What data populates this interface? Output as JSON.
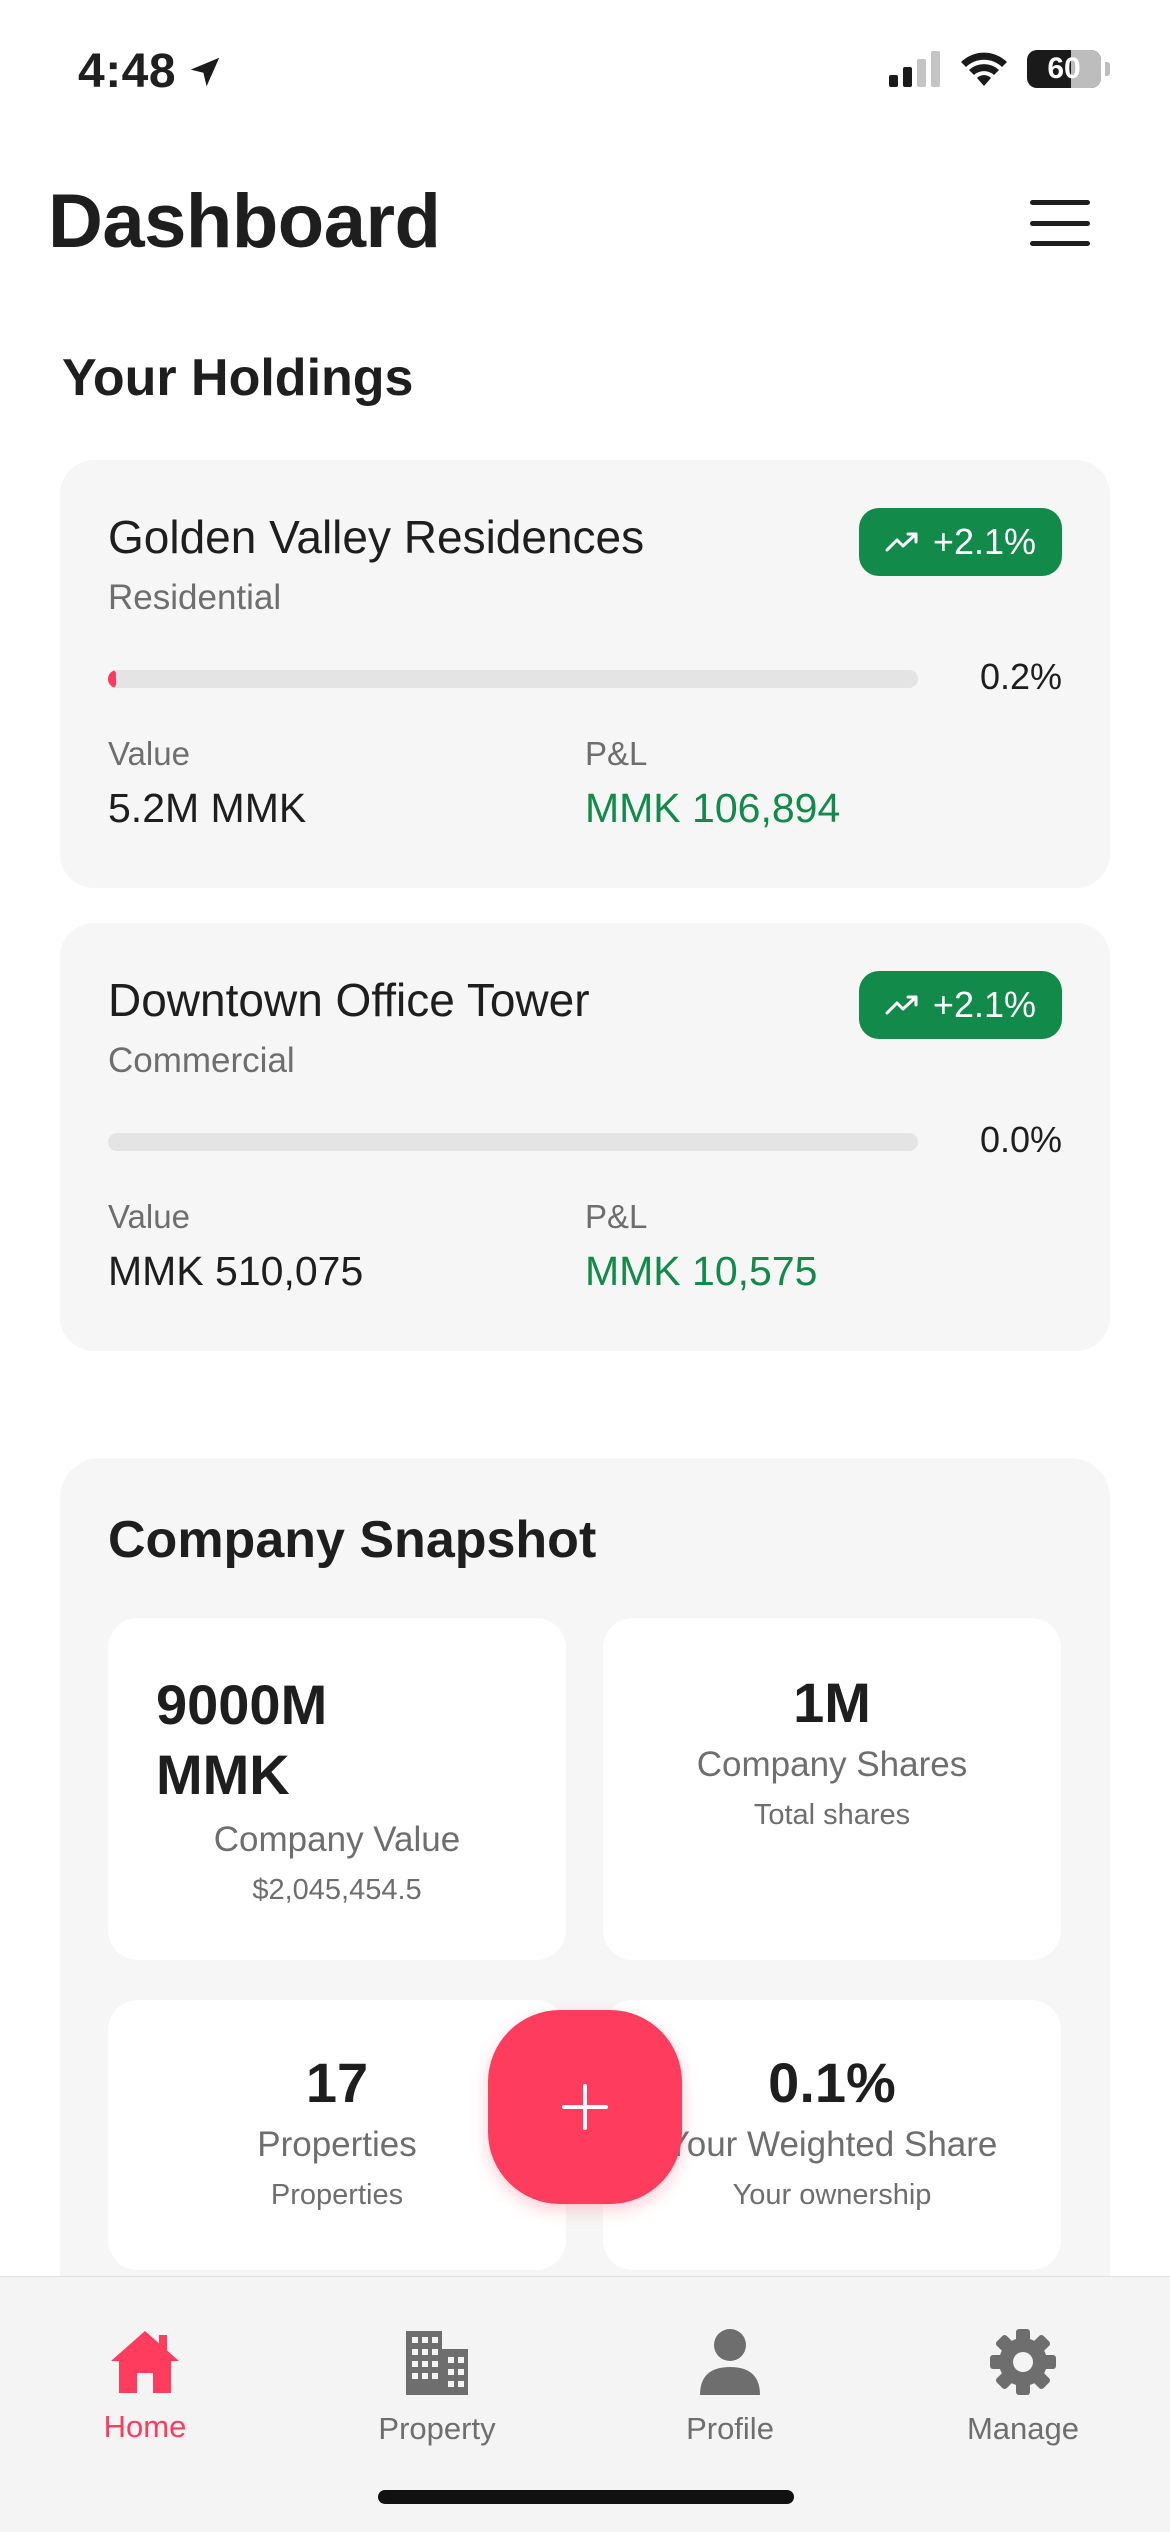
{
  "status_bar": {
    "time": "4:48",
    "battery": "60",
    "icons": [
      "location-arrow-icon",
      "cellular-signal-icon",
      "wifi-icon",
      "battery-icon"
    ]
  },
  "header": {
    "title": "Dashboard",
    "menu_icon": "hamburger-menu-icon"
  },
  "holdings": {
    "section_title": "Your Holdings",
    "items": [
      {
        "name": "Golden Valley Residences",
        "type": "Residential",
        "change": "+2.1%",
        "progress_label": "0.2%",
        "progress_fraction": 0.002,
        "value_label": "Value",
        "value": "5.2M MMK",
        "pl_label": "P&L",
        "pl_value": "MMK 106,894"
      },
      {
        "name": "Downtown Office Tower",
        "type": "Commercial",
        "change": "+2.1%",
        "progress_label": "0.0%",
        "progress_fraction": 0.0,
        "value_label": "Value",
        "value": "MMK 510,075",
        "pl_label": "P&L",
        "pl_value": "MMK 10,575"
      }
    ]
  },
  "snapshot": {
    "title": "Company Snapshot",
    "metrics": [
      {
        "value_line1": "9000M",
        "value_line2": "MMK",
        "label": "Company Value",
        "sub": "$2,045,454.5"
      },
      {
        "value": "1M",
        "label": "Company Shares",
        "sub": "Total shares"
      },
      {
        "value": "17",
        "label": "Properties",
        "sub": "Properties"
      },
      {
        "value": "0.1%",
        "label": "Your Weighted Share",
        "sub": "Your ownership"
      }
    ]
  },
  "fab": {
    "icon": "plus-icon"
  },
  "tab_bar": {
    "items": [
      {
        "label": "Home",
        "icon": "home-icon",
        "active": true
      },
      {
        "label": "Property",
        "icon": "building-icon",
        "active": false
      },
      {
        "label": "Profile",
        "icon": "person-icon",
        "active": false
      },
      {
        "label": "Manage",
        "icon": "gear-icon",
        "active": false
      }
    ]
  },
  "colors": {
    "accent": "#fe3c5d",
    "positive": "#118a4a",
    "card_bg": "#f6f6f6",
    "text_primary": "#1e1e1e",
    "text_secondary": "#6e6e6e"
  }
}
